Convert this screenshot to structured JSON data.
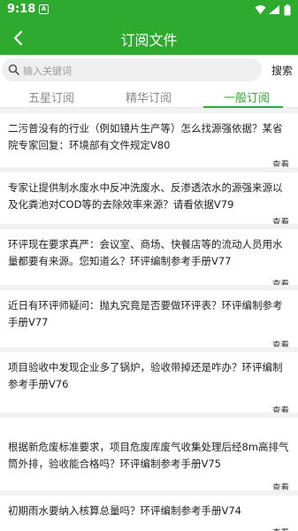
{
  "status_bar": {
    "time": "9:18",
    "notification": "A"
  },
  "app_bar": {
    "title": "订阅文件",
    "back_icon": "back-arrow-icon"
  },
  "search": {
    "placeholder": "输入关键词",
    "button_label": "搜索"
  },
  "tabs": [
    {
      "label": "五星订阅",
      "active": false
    },
    {
      "label": "精华订阅",
      "active": false
    },
    {
      "label": "一般订阅",
      "active": true
    }
  ],
  "items": [
    {
      "title": "二污普没有的行业（例如镜片生产等）怎么找源强依据？某省院专家回复：环境部有文件规定V80",
      "action": "查看"
    },
    {
      "title": "专家让提供制水废水中反冲洗废水、反渗透浓水的源强来源以及化粪池对COD等的去除效率来源？请看依据V79",
      "action": "查看"
    },
    {
      "title": "环评现在要求真严：会议室、商场、快餐店等的流动人员用水量都要有来源。您知道么？环评编制参考手册V77",
      "action": "查看"
    },
    {
      "title": "近日有环评师疑问：抛丸究竟是否要做环评表？环评编制参考手册V77",
      "action": "查看"
    },
    {
      "title": "项目验收中发现企业多了锅炉，验收带掉还是咋办？环评编制参考手册V76",
      "action": "查看"
    },
    {
      "title": "根据新危废标准要求，项目危废库废气收集处理后经8m高排气筒外排，验收能合格吗？环评编制参考手册V75",
      "action": "查看"
    },
    {
      "title": "初期雨水要纳入核算总量吗？环评编制参考手册V74",
      "action": "查看"
    }
  ],
  "colors": {
    "brand": "#2eaa2e",
    "background": "#ffffff",
    "divider": "#f2f2f2"
  }
}
